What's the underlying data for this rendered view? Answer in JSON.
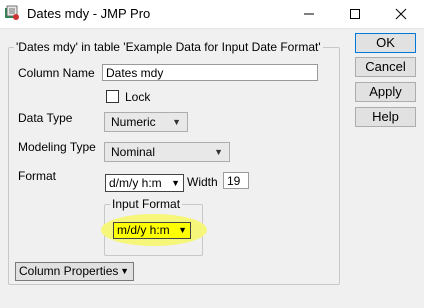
{
  "window": {
    "title": "Dates mdy - JMP Pro",
    "app_icon": "jmp-app-icon",
    "controls": [
      "minimize-icon",
      "maximize-icon",
      "close-icon"
    ]
  },
  "group": {
    "title": "'Dates mdy' in table 'Example Data for Input Date Format'"
  },
  "column_name": {
    "label": "Column Name",
    "value": "Dates mdy"
  },
  "lock": {
    "label": "Lock",
    "checked": false
  },
  "data_type": {
    "label": "Data Type",
    "value": "Numeric"
  },
  "modeling_type": {
    "label": "Modeling Type",
    "value": "Nominal"
  },
  "format": {
    "label": "Format",
    "value": "d/m/y h:m",
    "width_label": "Width",
    "width_value": "19"
  },
  "input_format": {
    "title": "Input Format",
    "value": "m/d/y h:m",
    "highlight_color": "#ffff00"
  },
  "column_properties": {
    "label": "Column Properties"
  },
  "buttons": {
    "ok": "OK",
    "cancel": "Cancel",
    "apply": "Apply",
    "help": "Help"
  },
  "arrow_glyph": "▼"
}
